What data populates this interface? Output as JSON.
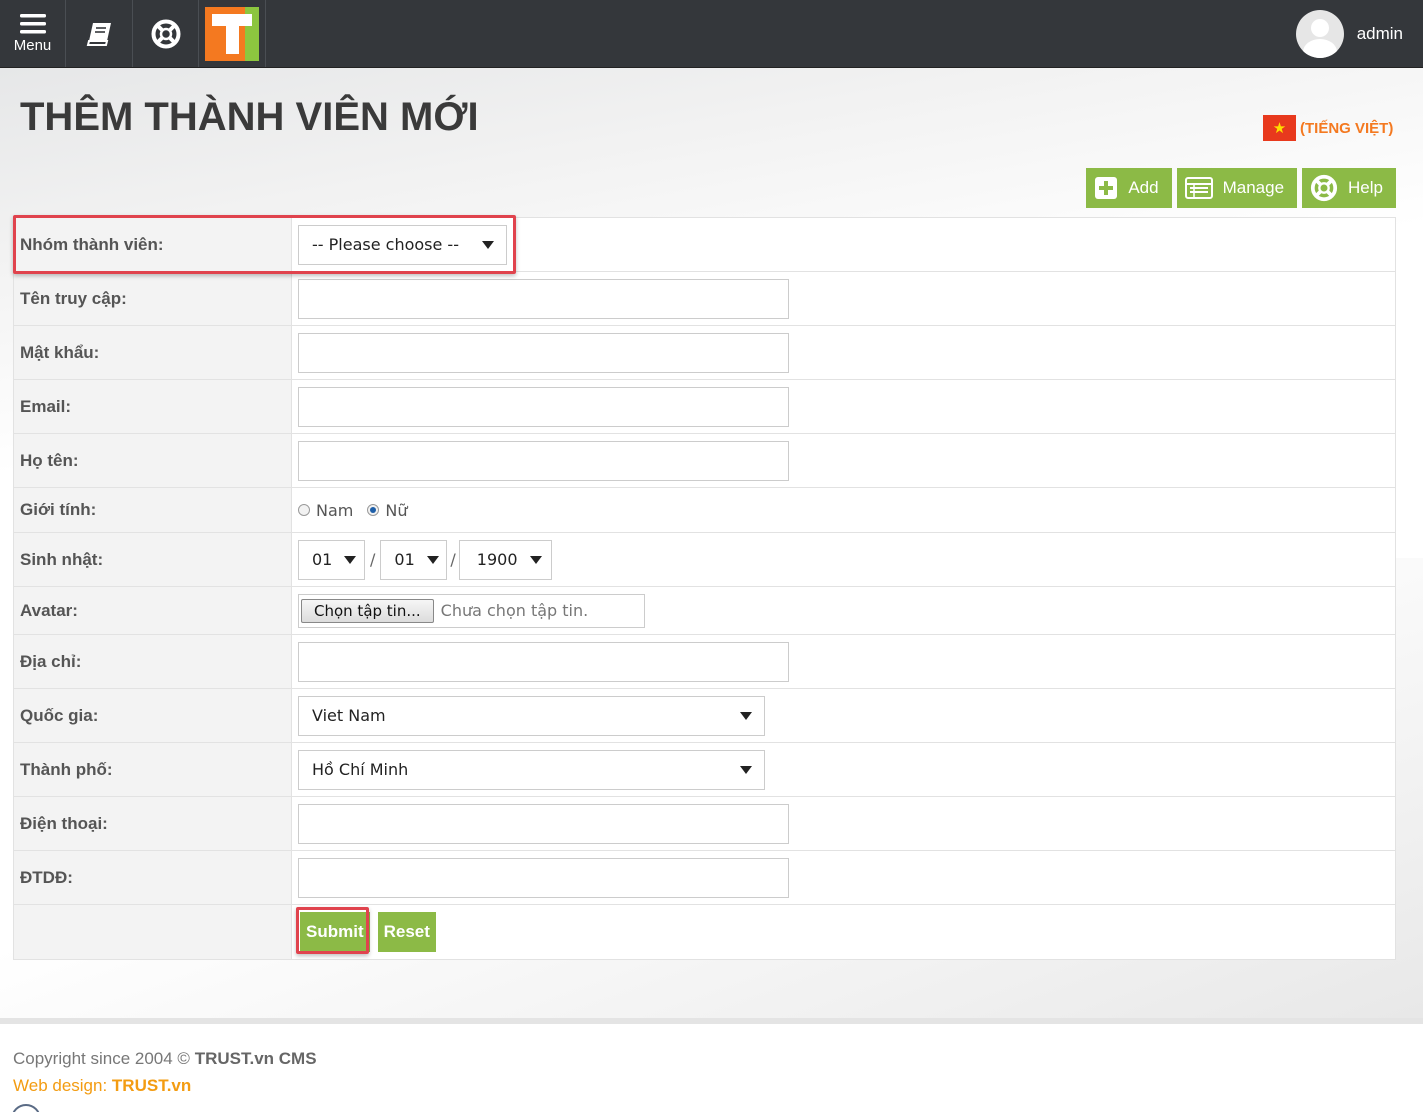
{
  "topbar": {
    "menu_label": "Menu",
    "username": "admin"
  },
  "page": {
    "title": "THÊM THÀNH VIÊN MỚI",
    "language": "(TIẾNG VIỆT)"
  },
  "actions": {
    "add": "Add",
    "manage": "Manage",
    "help": "Help"
  },
  "form": {
    "group_label": "Nhóm thành viên:",
    "group_value": "-- Please choose --",
    "username_label": "Tên truy cập:",
    "password_label": "Mật khẩu:",
    "email_label": "Email:",
    "fullname_label": "Họ tên:",
    "gender_label": "Giới tính:",
    "gender_male": "Nam",
    "gender_female": "Nữ",
    "gender_selected": "Nữ",
    "birthday_label": "Sinh nhật:",
    "birthday_day": "01",
    "birthday_month": "01",
    "birthday_year": "1900",
    "birthday_separator": "/",
    "avatar_label": "Avatar:",
    "avatar_button": "Chọn tập tin...",
    "avatar_status": "Chưa chọn tập tin.",
    "address_label": "Địa chỉ:",
    "country_label": "Quốc gia:",
    "country_value": "Viet Nam",
    "city_label": "Thành phố:",
    "city_value": "Hồ Chí Minh",
    "phone_label": "Điện thoại:",
    "mobile_label": "ĐTDĐ:",
    "submit": "Submit",
    "reset": "Reset"
  },
  "footer": {
    "copyright_prefix": "Copyright since 2004 © ",
    "copyright_brand": "TRUST.vn CMS",
    "webdesign_prefix": "Web design: ",
    "webdesign_brand": "TRUST.vn"
  },
  "colors": {
    "topbar": "#34373b",
    "accent_green": "#8cba46",
    "accent_orange": "#f47920",
    "highlight_red": "#e0434d"
  },
  "icons": {
    "menu": "hamburger-icon",
    "book": "book-icon",
    "help": "lifebuoy-icon",
    "add": "plus-icon",
    "manage": "list-icon"
  }
}
